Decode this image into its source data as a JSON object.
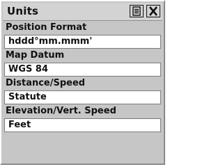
{
  "window": {
    "title": "Units",
    "menu_icon": "menu-icon",
    "close_icon": "close-icon"
  },
  "settings": [
    {
      "label": "Position Format",
      "value": "hddd°mm.mmm'"
    },
    {
      "label": "Map Datum",
      "value": "WGS 84"
    },
    {
      "label": "Distance/Speed",
      "value": "Statute"
    },
    {
      "label": "Elevation/Vert. Speed",
      "value": "Feet"
    }
  ]
}
